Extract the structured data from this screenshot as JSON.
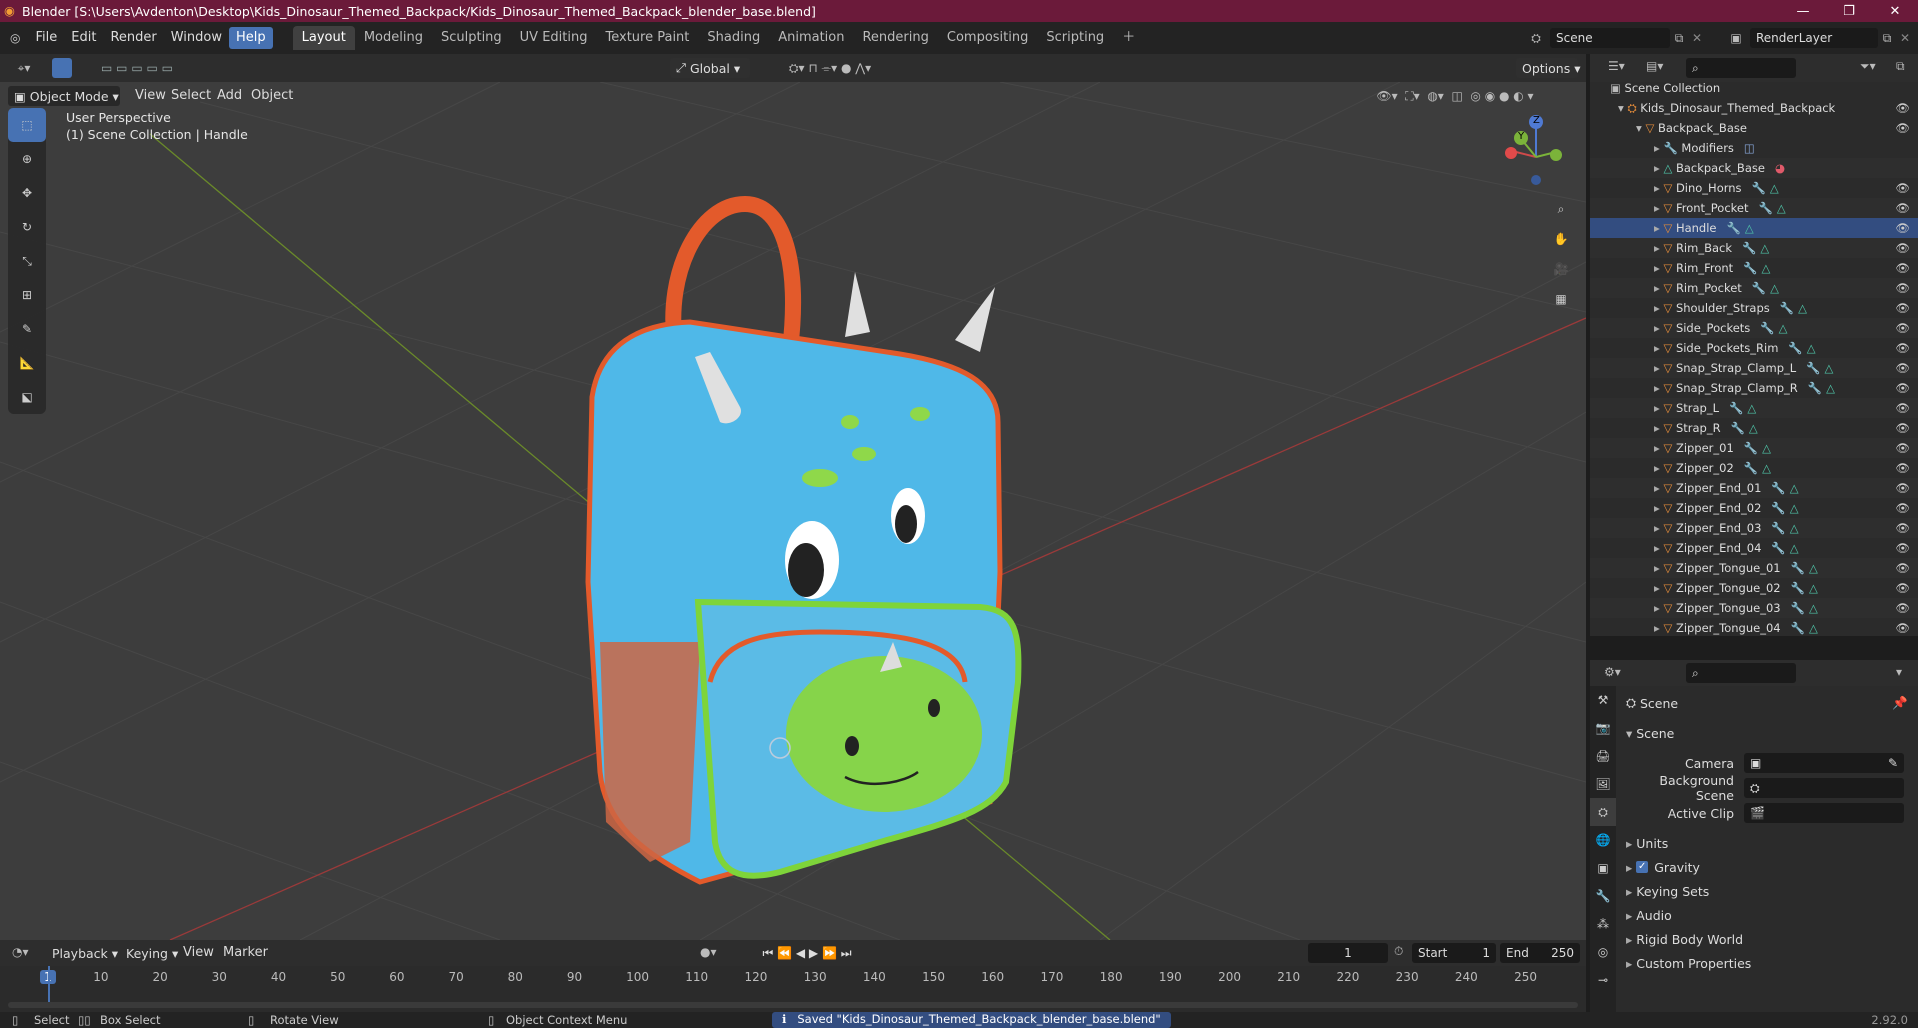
{
  "window": {
    "title": "Blender [S:\\Users\\Avdenton\\Desktop\\Kids_Dinosaur_Themed_Backpack/Kids_Dinosaur_Themed_Backpack_blender_base.blend]",
    "min": "—",
    "max": "❐",
    "close": "✕"
  },
  "menu": [
    "File",
    "Edit",
    "Render",
    "Window",
    "Help"
  ],
  "workspaces": [
    "Layout",
    "Modeling",
    "Sculpting",
    "UV Editing",
    "Texture Paint",
    "Shading",
    "Animation",
    "Rendering",
    "Compositing",
    "Scripting"
  ],
  "scene": {
    "name": "Scene",
    "layer": "RenderLayer"
  },
  "viewport": {
    "mode": "Object Mode",
    "menus": [
      "View",
      "Select",
      "Add",
      "Object"
    ],
    "orientation": "Global",
    "options": "Options",
    "perspective": "User Perspective",
    "collection_info": "(1) Scene Collection | Handle",
    "axes": {
      "x": "X",
      "y": "Y",
      "z": "Z"
    }
  },
  "outliner": {
    "root": "Scene Collection",
    "collection": "Kids_Dinosaur_Themed_Backpack",
    "parent": "Backpack_Base",
    "items": [
      "Modifiers",
      "Backpack_Base",
      "Dino_Horns",
      "Front_Pocket",
      "Handle",
      "Rim_Back",
      "Rim_Front",
      "Rim_Pocket",
      "Shoulder_Straps",
      "Side_Pockets",
      "Side_Pockets_Rim",
      "Snap_Strap_Clamp_L",
      "Snap_Strap_Clamp_R",
      "Strap_L",
      "Strap_R",
      "Zipper_01",
      "Zipper_02",
      "Zipper_End_01",
      "Zipper_End_02",
      "Zipper_End_03",
      "Zipper_End_04",
      "Zipper_Tongue_01",
      "Zipper_Tongue_02",
      "Zipper_Tongue_03",
      "Zipper_Tongue_04"
    ]
  },
  "properties": {
    "title": "Scene",
    "panel": "Scene",
    "camera": "Camera",
    "background_scene": "Background Scene",
    "active_clip": "Active Clip",
    "sections": [
      "Units",
      "Gravity",
      "Keying Sets",
      "Audio",
      "Rigid Body World",
      "Custom Properties"
    ]
  },
  "timeline": {
    "menus": [
      "Playback",
      "Keying",
      "View",
      "Marker"
    ],
    "current_frame": "1",
    "start_label": "Start",
    "start": "1",
    "end_label": "End",
    "end": "250",
    "ticks": [
      "1",
      "10",
      "20",
      "30",
      "40",
      "50",
      "60",
      "70",
      "80",
      "90",
      "100",
      "110",
      "120",
      "130",
      "140",
      "150",
      "160",
      "170",
      "180",
      "190",
      "200",
      "210",
      "220",
      "230",
      "240",
      "250"
    ]
  },
  "status": {
    "select": "Select",
    "box_select": "Box Select",
    "rotate": "Rotate View",
    "context": "Object Context Menu",
    "message": "Saved \"Kids_Dinosaur_Themed_Backpack_blender_base.blend\"",
    "version": "2.92.0"
  },
  "colors": {
    "title_bg": "#6b1a3a",
    "accent": "#4772b3",
    "viewport": "#3d3d3d"
  }
}
